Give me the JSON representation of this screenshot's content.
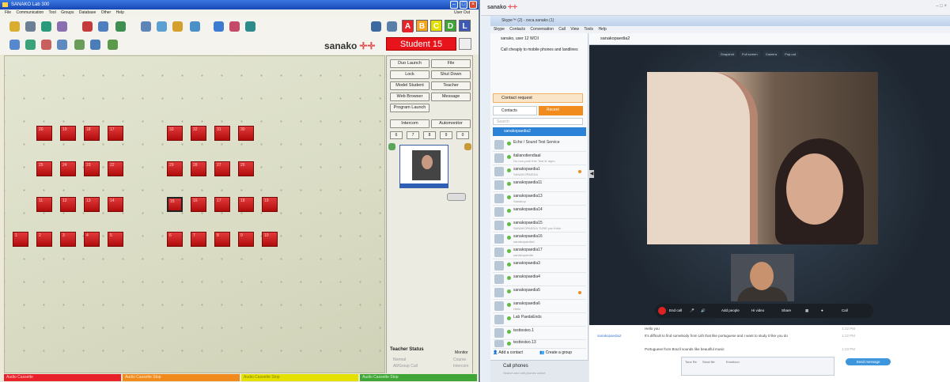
{
  "left": {
    "title": "SANAKO Lab 300",
    "menu": [
      "File",
      "Communication",
      "Tool",
      "Groups",
      "Database",
      "Other",
      "Help"
    ],
    "user_out": "User Out",
    "abc_groups": [
      {
        "label": "A",
        "color": "#e8222a"
      },
      {
        "label": "B",
        "color": "#f5a51e"
      },
      {
        "label": "C",
        "color": "#e4e000"
      },
      {
        "label": "D",
        "color": "#3fa536"
      },
      {
        "label": "L",
        "color": "#3d59b5"
      }
    ],
    "logo": "sanako",
    "student_label": "Student 15",
    "buttons": {
      "duo_launch": "Duo Launch",
      "file": "File",
      "lock": "Lock",
      "shut_down": "Shut Down",
      "model_student": "Model Student",
      "teacher": "Teacher",
      "web_browser": "Web Browser",
      "message": "Message",
      "program_launch": "Program Launch",
      "intercom": "Intercom",
      "automonitor": "Automonitor"
    },
    "keypad": [
      "6",
      "7",
      "8",
      "9",
      "0"
    ],
    "seats": [
      [
        "20",
        "19",
        "18",
        "17",
        "",
        "",
        "",
        "",
        "33",
        "32",
        "31",
        "30"
      ],
      [
        "25",
        "24",
        "23",
        "22",
        "",
        "",
        "",
        "",
        "29",
        "28",
        "27",
        "26"
      ],
      [
        "11",
        "12",
        "13",
        "14",
        "",
        "",
        "",
        "",
        "15",
        "16",
        "17",
        "18",
        "19"
      ],
      [
        "1",
        "2",
        "3",
        "4",
        "5",
        "",
        "",
        "",
        "6",
        "7",
        "8",
        "9",
        "10"
      ]
    ],
    "teacher_status": {
      "title": "Teacher Status",
      "monitor": "Monitor",
      "items": [
        "Normal",
        "All/Group Call"
      ],
      "right_items": [
        "Course",
        "Intercom"
      ]
    },
    "status_bars": [
      {
        "text": "Audio Cassette",
        "color": "#e8222a"
      },
      {
        "text": "Audio Cassette Stop",
        "color": "#f08a1c"
      },
      {
        "text": "Audio Cassette Stop",
        "color": "#e4e000"
      },
      {
        "text": "Audio Cassette Stop",
        "color": "#3fa536"
      }
    ]
  },
  "right": {
    "desk_logo": "sanako",
    "window_title": "Skype™ (2) - ovca.sanako (1)",
    "menu": [
      "Skype",
      "Contacts",
      "Conversation",
      "Call",
      "View",
      "Tools",
      "Help"
    ],
    "account": "sanako, user 12  WCII",
    "call_phones_header": "Call cheaply to mobile phones and landlines",
    "contact_request": "Contact request",
    "tabs": {
      "contacts": "Contacts",
      "recent": "Recent"
    },
    "search_placeholder": "Search",
    "selected": "sanakopaedia2",
    "contacts": [
      {
        "name": "Echo / Sound Test Service",
        "sub": ""
      },
      {
        "name": "italianotiendiaal",
        "sub": "Ho non-potrl free Test le lapro"
      },
      {
        "name": "sanakopaedia1",
        "sub": "SANAKOPAEDIA",
        "dot": true
      },
      {
        "name": "sanakopaedia11",
        "sub": ""
      },
      {
        "name": "sanakopaedia13",
        "sub": "Sanakop"
      },
      {
        "name": "sanakopaedia14",
        "sub": ""
      },
      {
        "name": "sanakopaedia15",
        "sub": "SANAKOPAEDIA TUNE you think"
      },
      {
        "name": "sanakopaedia16",
        "sub": "sanakopaedia1"
      },
      {
        "name": "sanakopaedia17",
        "sub": "sanakopaedia"
      },
      {
        "name": "sanakopaedia3",
        "sub": ""
      },
      {
        "name": "sanakopaedia4",
        "sub": ""
      },
      {
        "name": "sanakopaedia5",
        "sub": "",
        "dot": true
      },
      {
        "name": "sanakopaedia6",
        "sub": "Hello"
      },
      {
        "name": "Lab PaedaEnds",
        "sub": ""
      },
      {
        "name": "testtesteo.1",
        "sub": ""
      },
      {
        "name": "testtesteo.13",
        "sub": ""
      },
      {
        "name": "testtesteo.15",
        "sub": ""
      }
    ],
    "add_contact": "Add a contact",
    "create_conversation": "Create a group",
    "call_phones": "Call phones",
    "call_phones_sub": "Search and call phones online",
    "conversation_header": "sanakopaedia2",
    "video_options": [
      "Snapshot",
      "Full screen",
      "Camera",
      "Pop-out"
    ],
    "call_controls": [
      "End call",
      "Add people",
      "Hi video",
      "Share",
      "Call"
    ],
    "chat": [
      {
        "who": "",
        "msg": "Hello you",
        "time": "1:22 PM"
      },
      {
        "who": "sanakopaedia2",
        "msg": "It's difficult to find somebody from Lith that like portuguese and I want to study it like you do",
        "time": "1:22 PM"
      },
      {
        "who": "",
        "msg": "Portuguese from Brazil sounds like beautiful music",
        "time": "1:23 PM"
      }
    ],
    "chat_inputs": [
      "Tone Re",
      "Send file",
      "Emoticon"
    ],
    "send_button": "Send message"
  }
}
